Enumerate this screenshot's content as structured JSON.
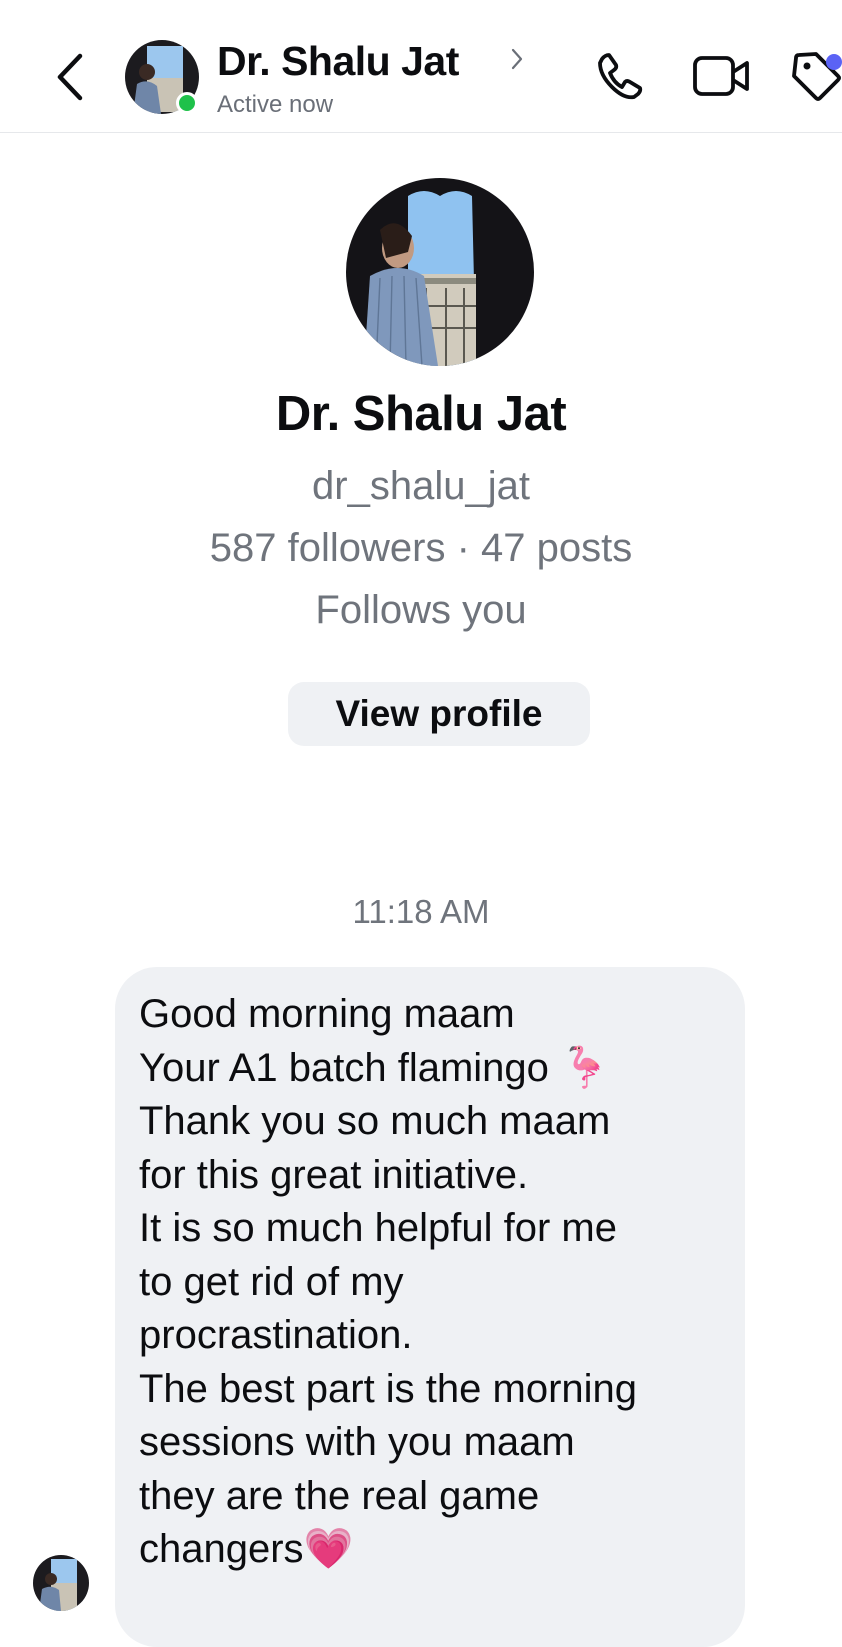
{
  "header": {
    "back_icon": "chevron-left-icon",
    "contact_name": "Dr. Shalu Jat",
    "status": "Active now",
    "actions": [
      "phone-icon",
      "video-icon",
      "tag-icon"
    ],
    "online_color": "#1fc14a",
    "notification_dot_color": "#5b63f5"
  },
  "profile": {
    "name": "Dr. Shalu Jat",
    "username": "dr_shalu_jat",
    "stats": "587 followers · 47 posts",
    "relationship": "Follows you",
    "view_profile_label": "View profile"
  },
  "conversation": {
    "timestamp": "11:18 AM",
    "message": {
      "lines": [
        "Good morning maam",
        "Your A1 batch flamingo 🦩",
        "Thank you so much maam",
        "for this great initiative.",
        "It is so much helpful for me",
        "to get rid of my",
        "procrastination.",
        "The best part is the morning",
        "sessions with you maam",
        "they are the real game",
        "changers💗"
      ]
    }
  }
}
